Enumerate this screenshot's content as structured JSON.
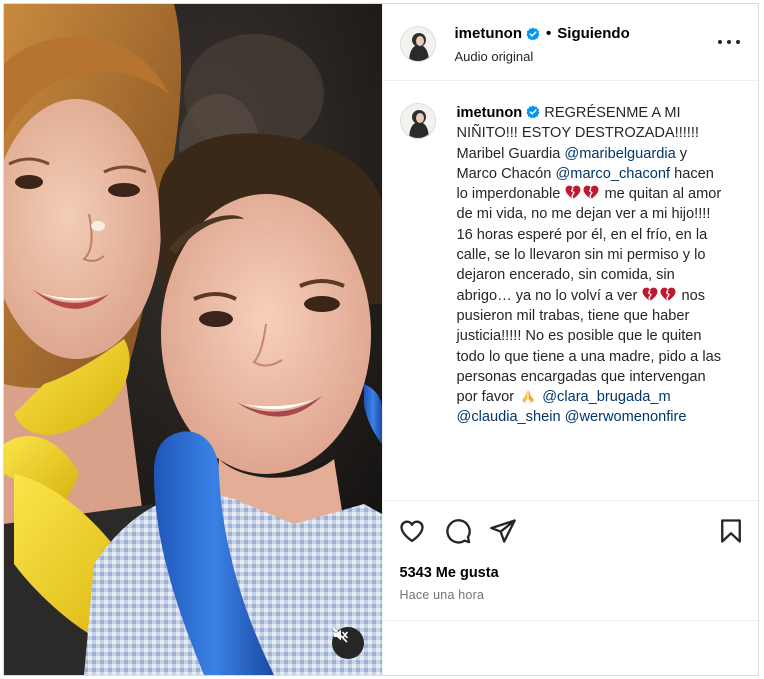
{
  "post": {
    "username": "imetunon",
    "separator": "•",
    "follow_status": "Siguiendo",
    "audio_label": "Audio original",
    "caption": {
      "segments": [
        {
          "type": "text",
          "text": " REGRÉSENME A MI NIÑITO!!! ESTOY DESTROZADA!!!!!! Maribel Guardia "
        },
        {
          "type": "mention",
          "text": "@maribelguardia"
        },
        {
          "type": "text",
          "text": " y Marco Chacón "
        },
        {
          "type": "mention",
          "text": "@marco_chaconf"
        },
        {
          "type": "text",
          "text": " hacen lo imperdonable "
        },
        {
          "type": "emoji",
          "name": "broken-heart"
        },
        {
          "type": "emoji",
          "name": "broken-heart"
        },
        {
          "type": "text",
          "text": " me quitan al amor de mi vida, no me dejan ver a mi hijo!!!! 16 horas esperé por él, en el frío, en la calle, se lo llevaron sin mi permiso y lo dejaron encerado, sin comida, sin abrigo… ya no lo volví a ver "
        },
        {
          "type": "emoji",
          "name": "broken-heart"
        },
        {
          "type": "emoji",
          "name": "broken-heart"
        },
        {
          "type": "text",
          "text": " nos pusieron mil trabas, tiene que haber justicia!!!!! No es posible que le quiten todo lo que tiene a una madre, pido a las personas encargadas que intervengan por favor "
        },
        {
          "type": "emoji",
          "name": "folded-hands"
        },
        {
          "type": "text",
          "text": " "
        },
        {
          "type": "mention",
          "text": "@clara_brugada_m"
        },
        {
          "type": "text",
          "text": " "
        },
        {
          "type": "mention",
          "text": "@claudia_shein"
        },
        {
          "type": "text",
          "text": " "
        },
        {
          "type": "mention",
          "text": "@werwomenonfire"
        }
      ]
    },
    "likes_text": "5343 Me gusta",
    "time_text": "Hace una hora"
  },
  "icons": {
    "like": "heart-outline-icon",
    "comment": "comment-icon",
    "share": "paper-plane-icon",
    "save": "bookmark-icon",
    "mute": "speaker-muted-icon",
    "more": "more-options-icon",
    "verified": "verified-badge-icon"
  },
  "colors": {
    "mention": "#00376b",
    "verified": "#0095f6",
    "broken_heart": "#be1931",
    "secondary_text": "#737373",
    "balloon_blue": "#2f6fd6",
    "balloon_yellow": "#f2d21a"
  }
}
